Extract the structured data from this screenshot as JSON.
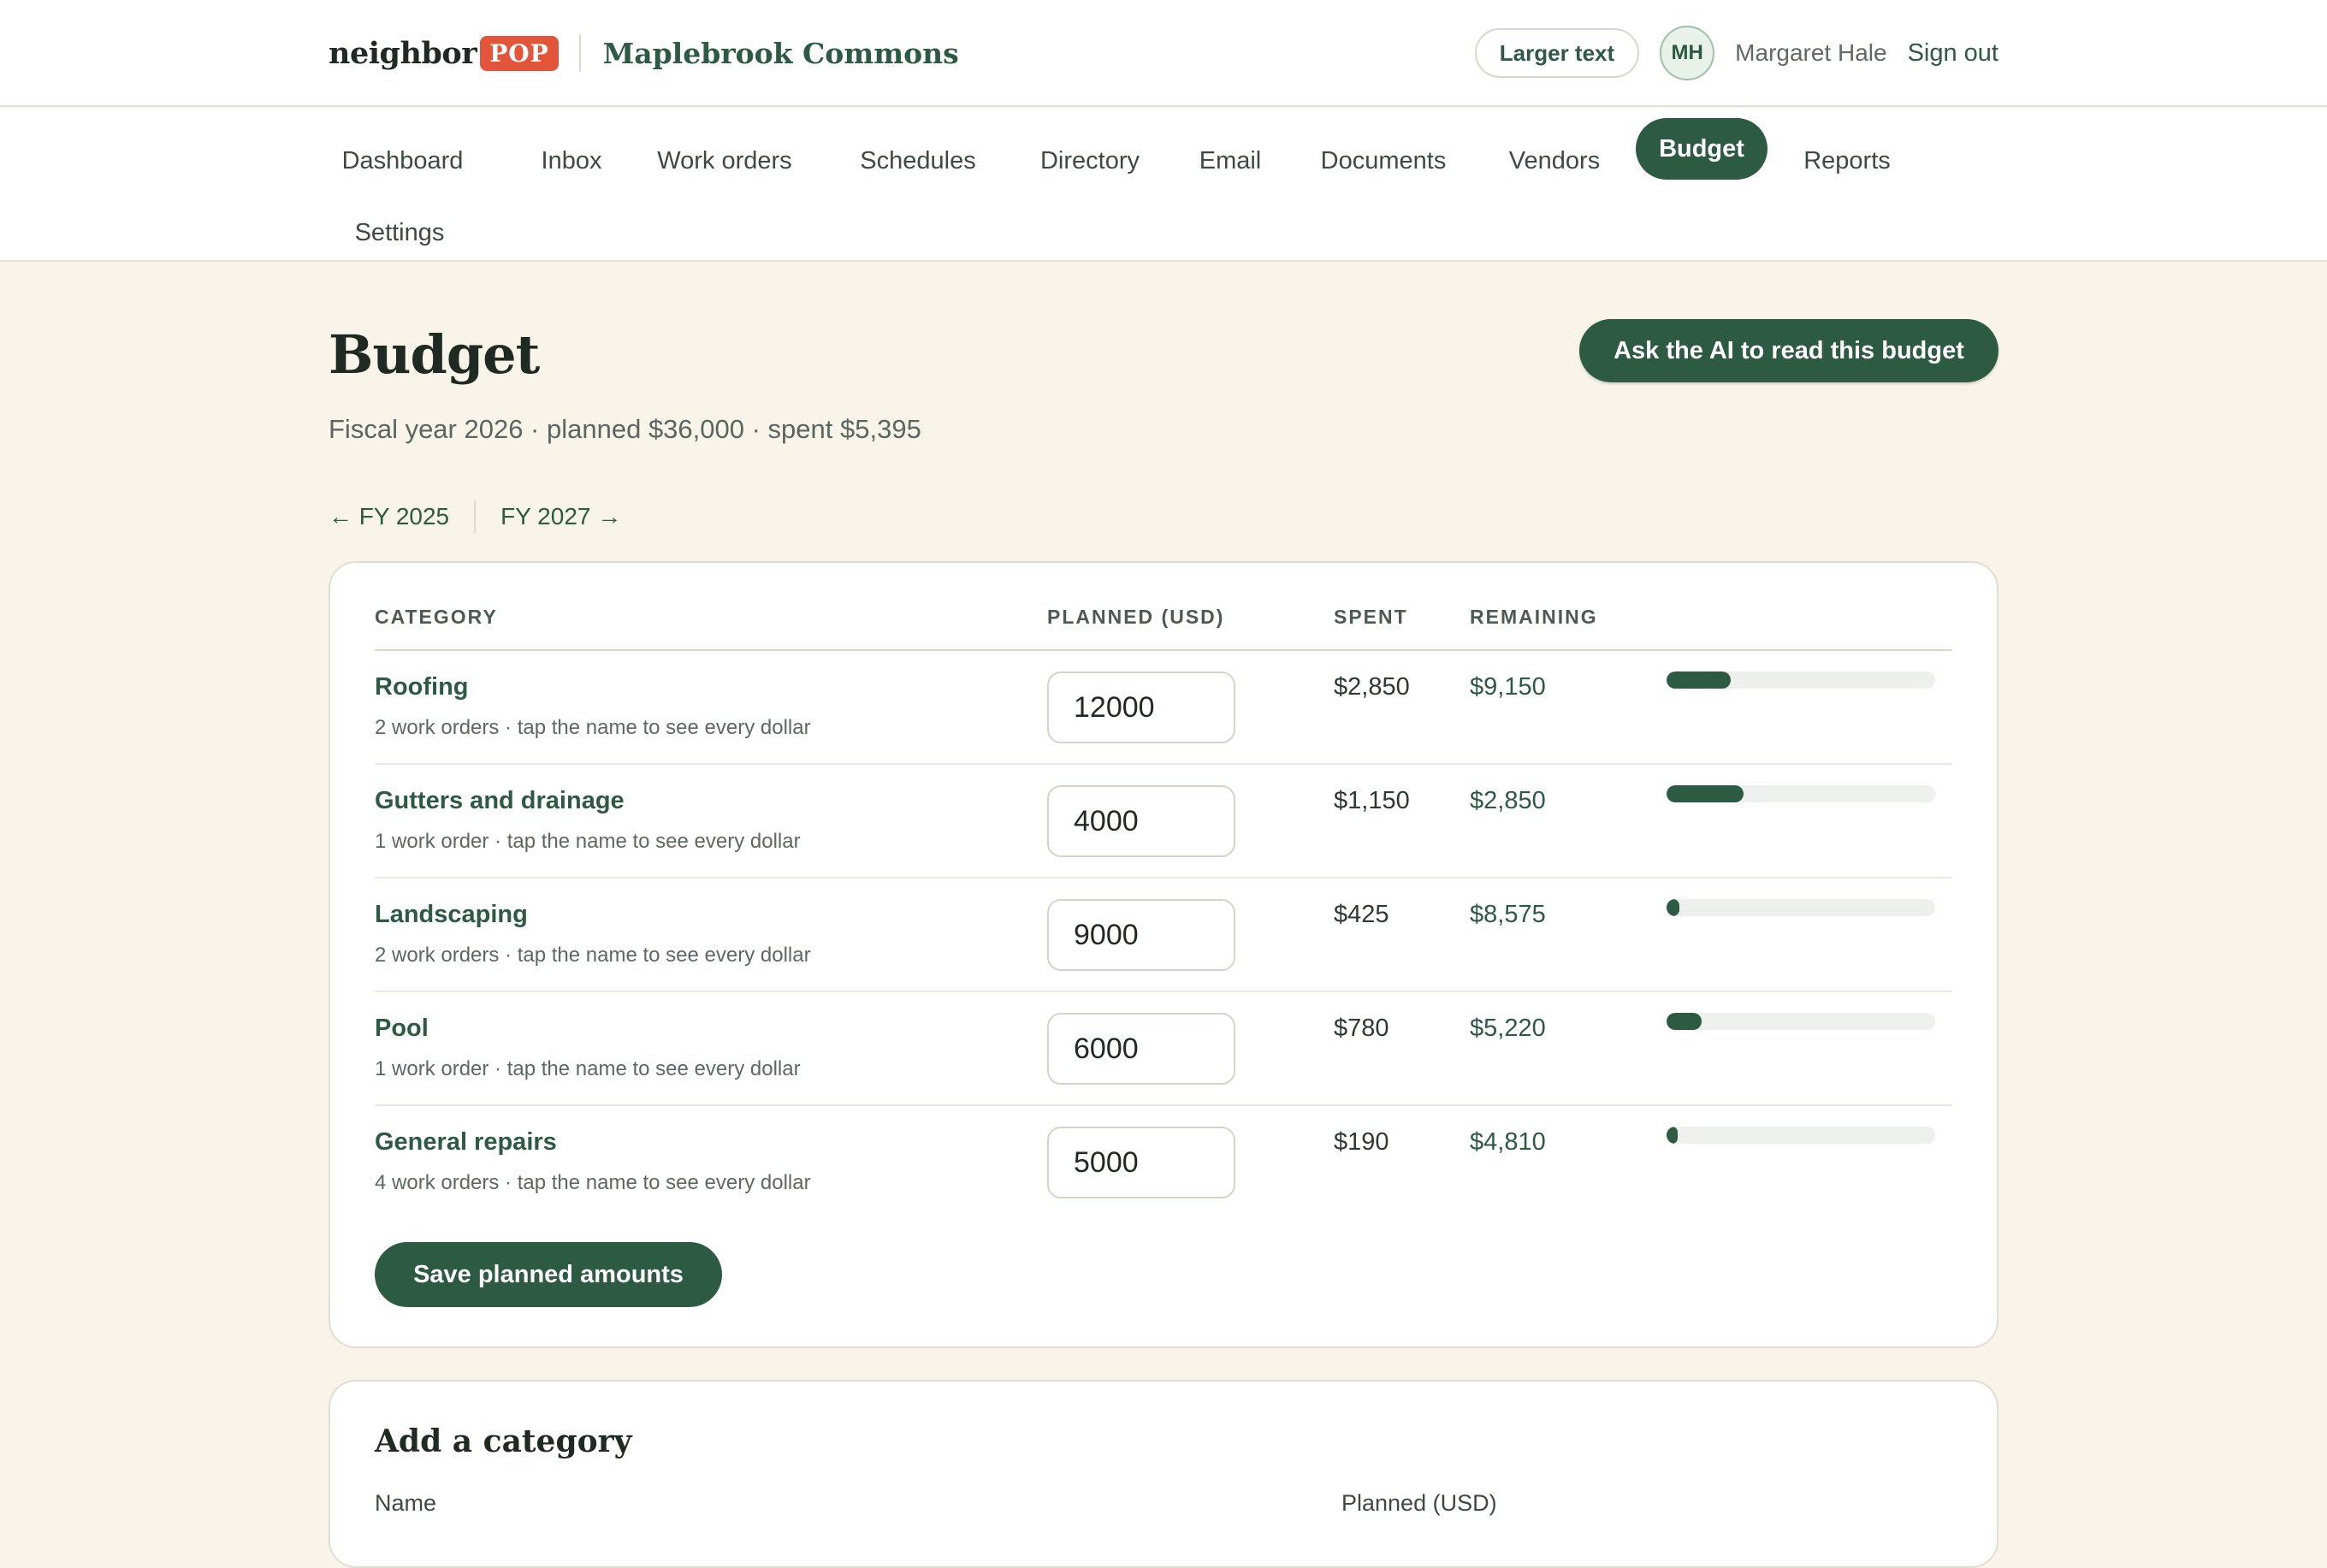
{
  "brand": {
    "word": "neighbor",
    "badge": "POP",
    "community": "Maplebrook Commons"
  },
  "header": {
    "larger_text": "Larger text",
    "avatar_initials": "MH",
    "user_name": "Margaret Hale",
    "sign_out": "Sign out"
  },
  "nav": {
    "items": [
      {
        "label": "Dashboard"
      },
      {
        "label": "Inbox"
      },
      {
        "label": "Work orders"
      },
      {
        "label": "Schedules"
      },
      {
        "label": "Directory"
      },
      {
        "label": "Email"
      },
      {
        "label": "Documents"
      },
      {
        "label": "Vendors"
      },
      {
        "label": "Budget",
        "active": true
      },
      {
        "label": "Reports"
      },
      {
        "label": "Settings"
      }
    ]
  },
  "page": {
    "title": "Budget",
    "subtitle": "Fiscal year 2026 · planned $36,000 · spent $5,395",
    "ask_ai": "Ask the AI to read this budget",
    "prev_year": "← FY 2025",
    "next_year": "FY 2027 →"
  },
  "table": {
    "headers": {
      "category": "CATEGORY",
      "planned": "PLANNED (USD)",
      "spent": "SPENT",
      "remaining": "REMAINING"
    },
    "rows": [
      {
        "name": "Roofing",
        "hint": "2 work orders · tap the name to see every dollar",
        "planned": "12000",
        "spent": "$2,850",
        "remaining": "$9,150",
        "spent_fraction": 0.2375
      },
      {
        "name": "Gutters and drainage",
        "hint": "1 work order · tap the name to see every dollar",
        "planned": "4000",
        "spent": "$1,150",
        "remaining": "$2,850",
        "spent_fraction": 0.2875
      },
      {
        "name": "Landscaping",
        "hint": "2 work orders · tap the name to see every dollar",
        "planned": "9000",
        "spent": "$425",
        "remaining": "$8,575",
        "spent_fraction": 0.0472
      },
      {
        "name": "Pool",
        "hint": "1 work order · tap the name to see every dollar",
        "planned": "6000",
        "spent": "$780",
        "remaining": "$5,220",
        "spent_fraction": 0.13
      },
      {
        "name": "General repairs",
        "hint": "4 work orders · tap the name to see every dollar",
        "planned": "5000",
        "spent": "$190",
        "remaining": "$4,810",
        "spent_fraction": 0.038
      }
    ],
    "save_label": "Save planned amounts"
  },
  "add_category": {
    "title": "Add a category",
    "name_label": "Name",
    "planned_label": "Planned (USD)"
  },
  "colors": {
    "accent": "#2d5a42",
    "brand_badge": "#e2553a",
    "background": "#f8f4ea"
  }
}
